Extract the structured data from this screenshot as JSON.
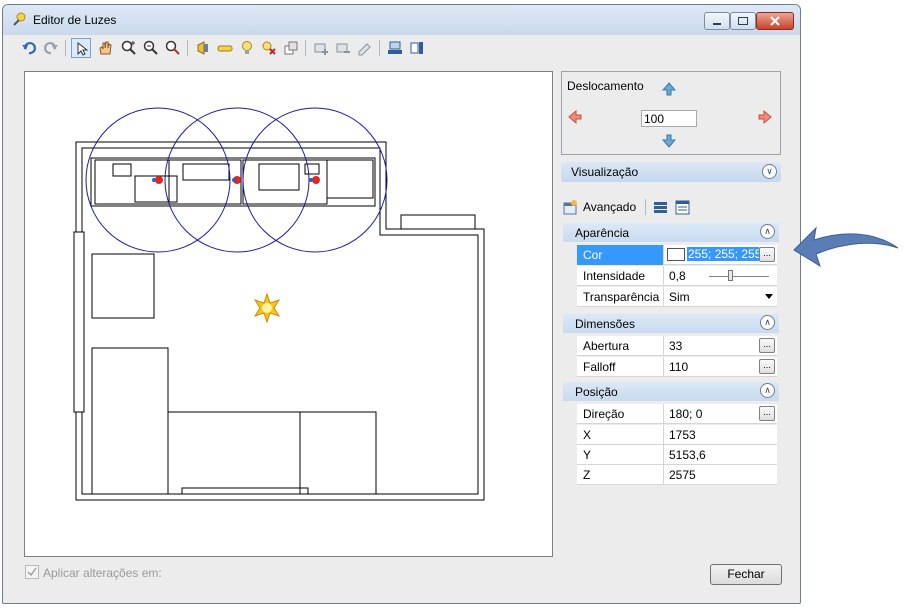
{
  "window": {
    "title": "Editor de Luzes"
  },
  "toolbar": {
    "icons": [
      "undo-icon",
      "redo-icon",
      "select-icon",
      "pan-hand-icon",
      "zoom-in-icon",
      "zoom-out-icon",
      "zoom-extents-icon",
      "spot-light-icon",
      "linear-light-icon",
      "bulb-icon",
      "delete-light-icon",
      "layer-icon",
      "add-group-icon",
      "remove-group-icon",
      "edit-group-icon",
      "elevation-view-icon",
      "side-view-icon"
    ]
  },
  "offset": {
    "label": "Deslocamento",
    "value": "100"
  },
  "visualization": {
    "label": "Visualização"
  },
  "tabs": {
    "advanced_label": "Avançado"
  },
  "properties": {
    "appearance": {
      "label": "Aparência",
      "color_label": "Cor",
      "color_value": "255; 255; 255",
      "intensity_label": "Intensidade",
      "intensity_value": "0,8",
      "intensity_slider": 0.35,
      "transparency_label": "Transparência",
      "transparency_value": "Sim"
    },
    "dimensions": {
      "label": "Dimensões",
      "aperture_label": "Abertura",
      "aperture_value": "33",
      "falloff_label": "Falloff",
      "falloff_value": "110"
    },
    "position": {
      "label": "Posição",
      "direction_label": "Direção",
      "direction_value": "180; 0",
      "x_label": "X",
      "x_value": "1753",
      "y_label": "Y",
      "y_value": "5153,6",
      "z_label": "Z",
      "z_value": "2575"
    },
    "ellipsis": "..."
  },
  "footer": {
    "apply_label": "Aplicar alterações em:",
    "close_label": "Fechar"
  },
  "colors": {
    "accent": "#3399ff",
    "section": "#c5d8ee",
    "callout": "#5b7db5"
  }
}
